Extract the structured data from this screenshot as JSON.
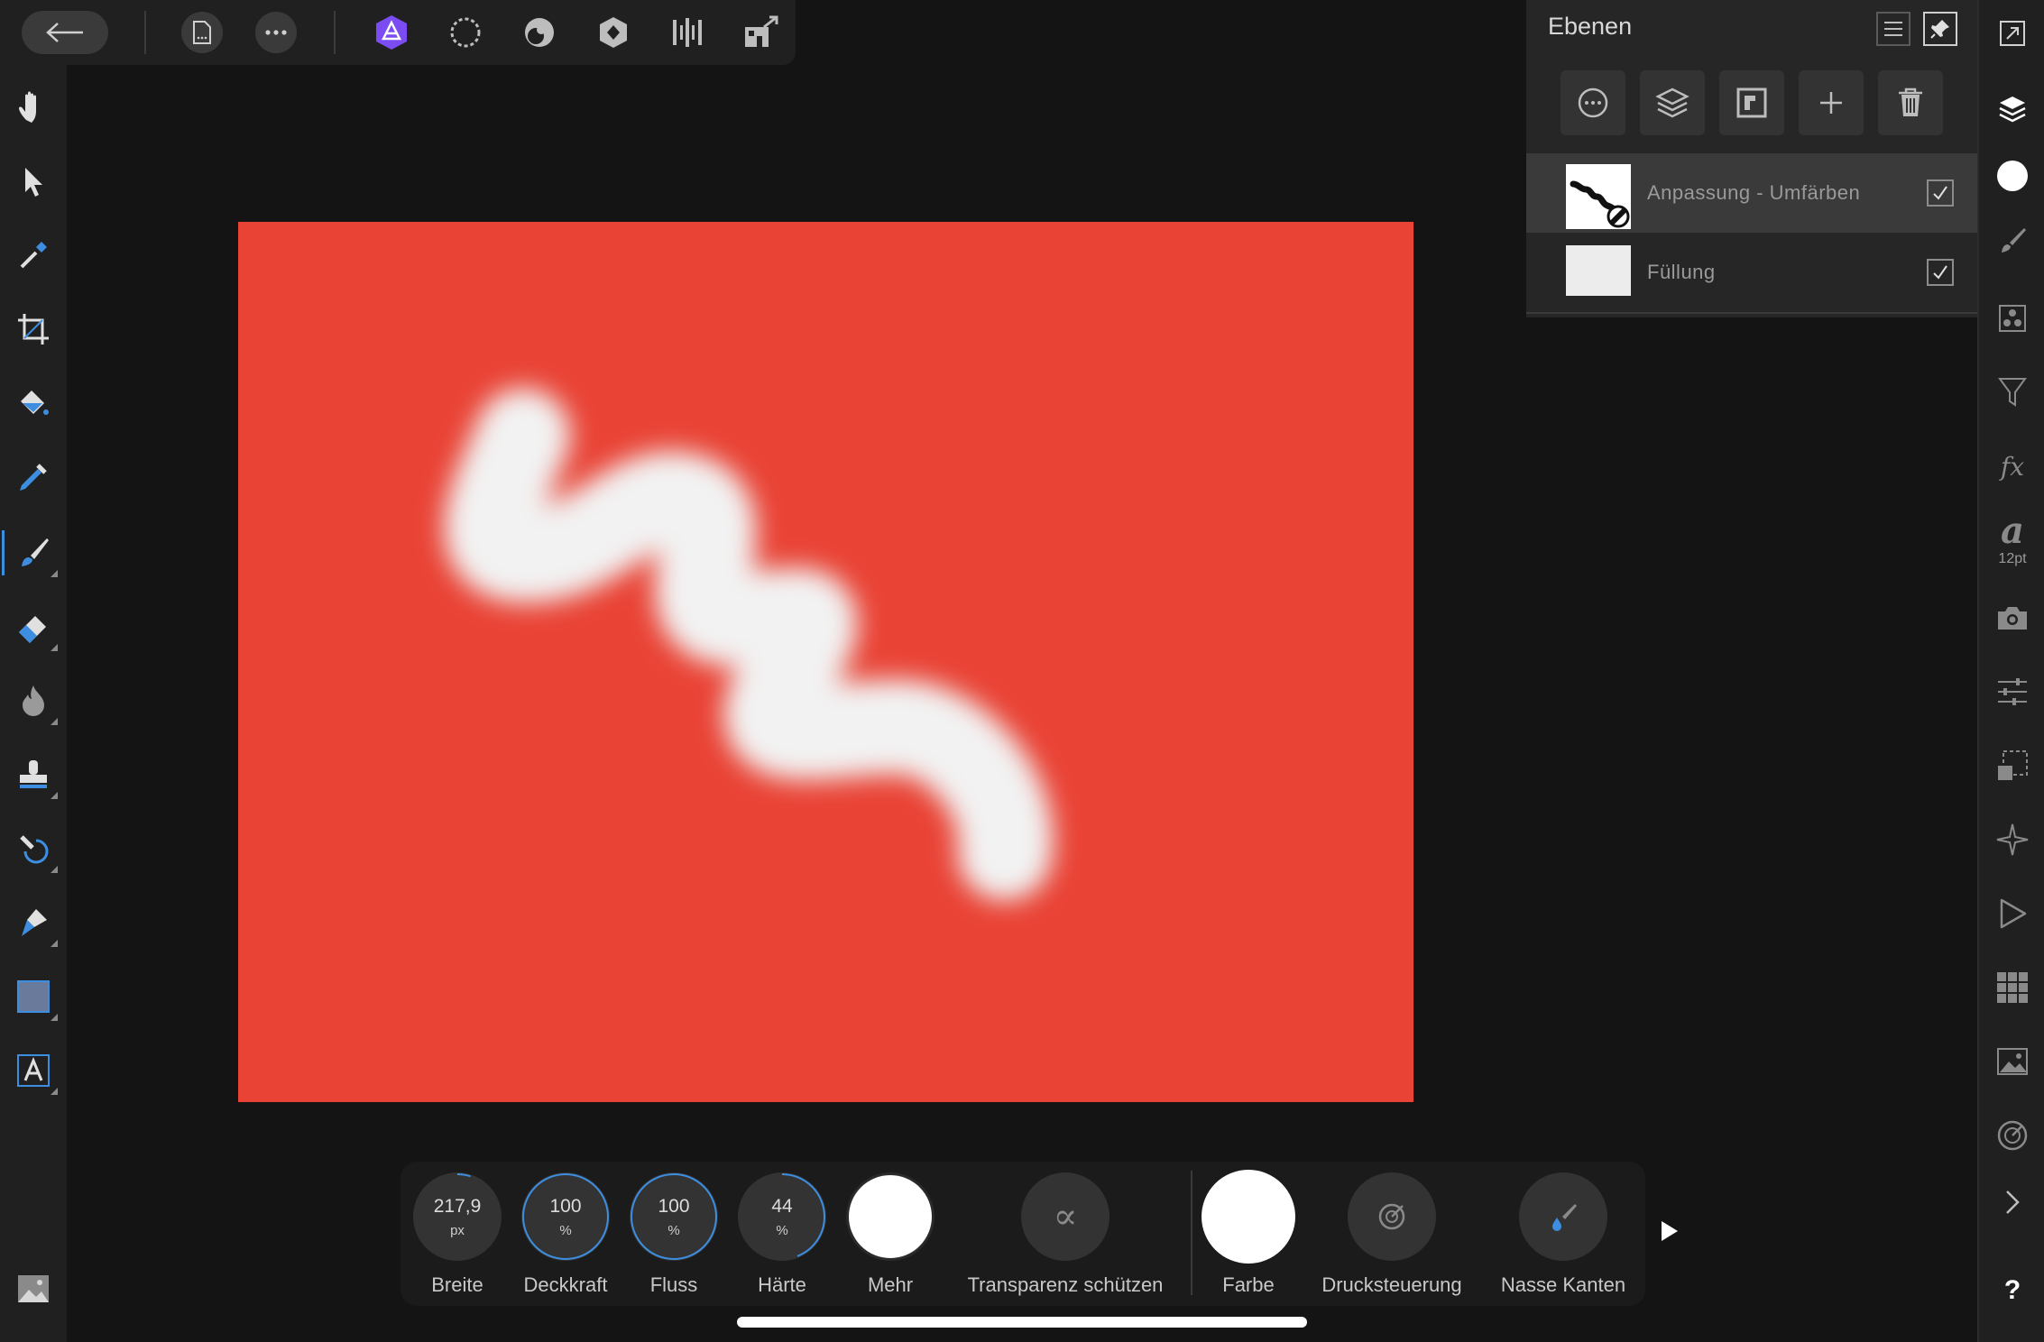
{
  "layers_panel": {
    "title": "Ebenen",
    "layers": [
      {
        "name": "Anpassung - Umfärben",
        "checked": true,
        "selected": true
      },
      {
        "name": "Füllung",
        "checked": true,
        "selected": false
      }
    ]
  },
  "context_toolbar": {
    "width": {
      "value": "217,9",
      "unit": "px",
      "label": "Breite",
      "fraction": 0.05
    },
    "opacity": {
      "value": "100",
      "unit": "%",
      "label": "Deckkraft",
      "fraction": 1.0
    },
    "flow": {
      "value": "100",
      "unit": "%",
      "label": "Fluss",
      "fraction": 1.0
    },
    "hardness": {
      "value": "44",
      "unit": "%",
      "label": "Härte",
      "fraction": 0.44
    },
    "more_label": "Mehr",
    "protect_alpha_label": "Transparenz schützen",
    "protect_alpha_glyph": "∝",
    "color_label": "Farbe",
    "pressure_label": "Drucksteuerung",
    "wet_edges_label": "Nasse Kanten"
  },
  "right_toolbar": {
    "text_glyph": "a",
    "font_size": "12pt",
    "fx_glyph": "fx",
    "help_glyph": "?"
  },
  "colors": {
    "canvas_fill": "#e94335",
    "accent_blue": "#3d8ee0",
    "persona_purple": "#7a4cf2",
    "brush_color": "#ffffff"
  },
  "icons": {
    "back": "back-arrow-icon",
    "document": "document-icon",
    "more": "more-icon",
    "personas": [
      "photo-persona-icon",
      "liquify-persona-icon",
      "develop-persona-icon",
      "tone-mapping-persona-icon",
      "export-persona-icon",
      "share-icon"
    ]
  }
}
